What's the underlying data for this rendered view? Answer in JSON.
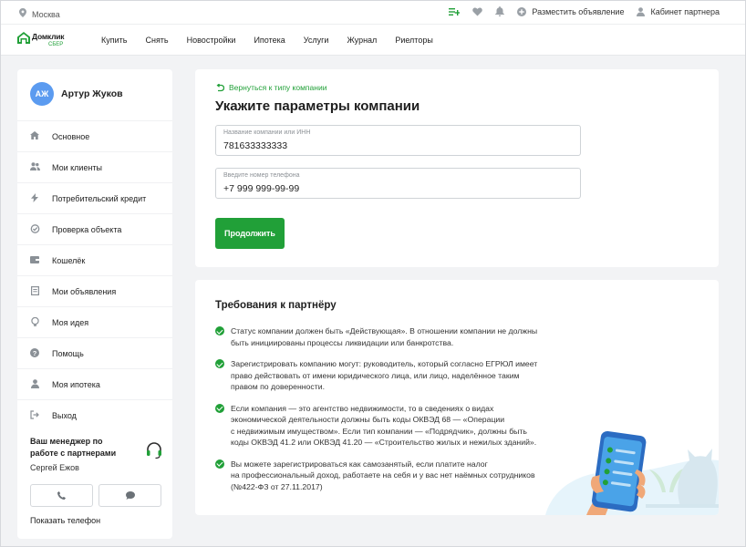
{
  "topbar": {
    "city": "Москва",
    "post_ad": "Разместить объявление",
    "partner_cabinet": "Кабинет партнера"
  },
  "nav": {
    "logo_name": "Домклик",
    "logo_sub": "СБЕР",
    "links": [
      "Купить",
      "Снять",
      "Новостройки",
      "Ипотека",
      "Услуги",
      "Журнал",
      "Риелторы"
    ]
  },
  "sidebar": {
    "avatar_initials": "АЖ",
    "user_name": "Артур Жуков",
    "items": [
      {
        "label": "Основное"
      },
      {
        "label": "Мои клиенты"
      },
      {
        "label": "Потребительский кредит"
      },
      {
        "label": "Проверка объекта"
      },
      {
        "label": "Кошелёк"
      },
      {
        "label": "Мои объявления"
      },
      {
        "label": "Моя идея"
      },
      {
        "label": "Помощь"
      },
      {
        "label": "Моя ипотека"
      },
      {
        "label": "Выход"
      }
    ],
    "manager_title": "Ваш менеджер по работе с партнерами",
    "manager_name": "Сергей Ежов",
    "show_phone": "Показать телефон"
  },
  "form": {
    "back_link": "Вернуться к типу компании",
    "title": "Укажите параметры компании",
    "company_label": "Название компании или ИНН",
    "company_value": "781633333333",
    "phone_label": "Введите номер телефона",
    "phone_value": "+7 999 999-99-99",
    "continue": "Продолжить"
  },
  "requirements": {
    "title": "Требования к партнёру",
    "items": [
      "Статус компании должен быть «Действующая». В отношении компании не должны\nбыть инициированы процессы ликвидации или банкротства.",
      "Зарегистрировать компанию могут: руководитель, который согласно ЕГРЮЛ имеет\nправо действовать от имени юридического лица, или лицо, наделённое таким\nправом по доверенности.",
      "Если компания — это агентство недвижимости, то в сведениях о видах\nэкономической деятельности должны быть коды ОКВЭД 68 — «Операции\nс недвижимым имуществом». Если тип компании — «Подрядчик», должны быть\nкоды ОКВЭД 41.2 или ОКВЭД 41.20 — «Строительство жилых и нежилых зданий».",
      "Вы можете зарегистрироваться как самозанятый, если платите налог\nна профессиональный доход, работаете на себя и у вас нет наёмных сотрудников\n(№422-ФЗ от 27.11.2017)"
    ]
  },
  "colors": {
    "accent": "#21a038",
    "avatar": "#5b9bf0",
    "background": "#f2f3f5"
  }
}
